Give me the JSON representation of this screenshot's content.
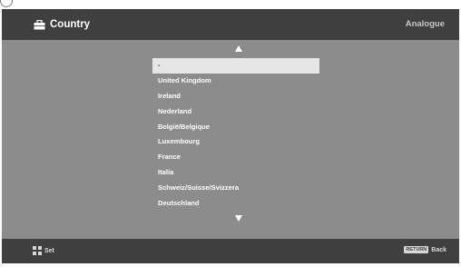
{
  "header": {
    "title": "Country",
    "mode": "Analogue",
    "icon": "briefcase-icon"
  },
  "list": {
    "items": [
      {
        "label": "-",
        "selected": true
      },
      {
        "label": "United Kingdom",
        "selected": false
      },
      {
        "label": "Ireland",
        "selected": false
      },
      {
        "label": "Nederland",
        "selected": false
      },
      {
        "label": "België/Belgique",
        "selected": false
      },
      {
        "label": "Luxembourg",
        "selected": false
      },
      {
        "label": "France",
        "selected": false
      },
      {
        "label": "Italia",
        "selected": false
      },
      {
        "label": "Schweiz/Suisse/Svizzera",
        "selected": false
      },
      {
        "label": "Deutschland",
        "selected": false
      }
    ]
  },
  "footer": {
    "set_label": "Set",
    "return_key": "RETURN",
    "back_label": "Back"
  },
  "colors": {
    "background": "#8c8c8c",
    "bar": "#3f3f3f",
    "selected_row": "#e6e6e6"
  }
}
